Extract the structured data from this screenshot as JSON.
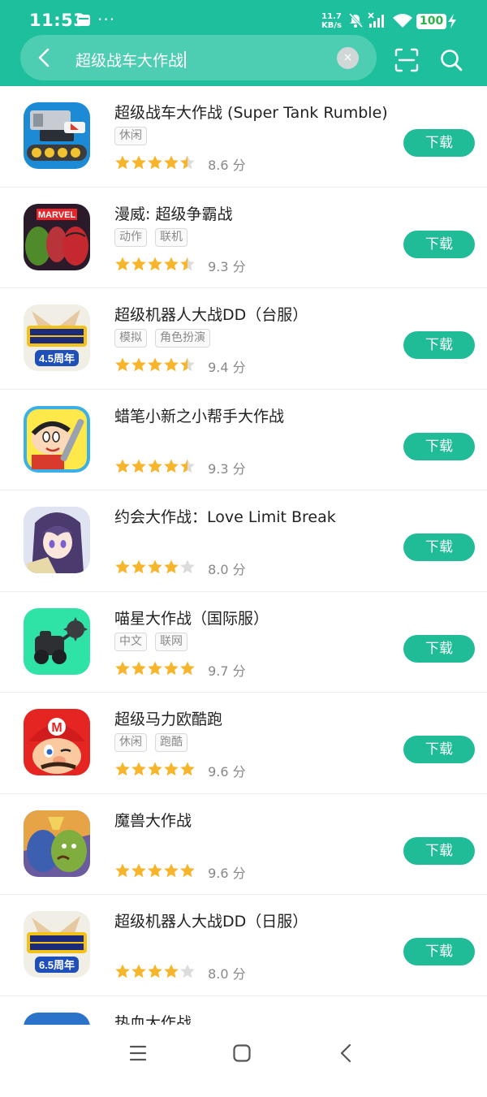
{
  "status": {
    "time": "11:53",
    "dots": "···",
    "net_speed": "11.7",
    "net_unit": "KB/s",
    "battery": "100"
  },
  "search": {
    "query": "超级战车大作战",
    "clear_symbol": "×"
  },
  "apps": [
    {
      "name": "超级战车大作战 (Super Tank Rumble)",
      "tags": [
        "休闲"
      ],
      "rating": 4.5,
      "score": "8.6 分",
      "button": "下载",
      "icon": "super-tank-rumble-icon"
    },
    {
      "name": "漫威: 超级争霸战",
      "tags": [
        "动作",
        "联机"
      ],
      "rating": 4.5,
      "score": "9.3 分",
      "button": "下载",
      "icon": "marvel-contest-icon"
    },
    {
      "name": "超级机器人大战DD（台服）",
      "tags": [
        "模拟",
        "角色扮演"
      ],
      "rating": 4.5,
      "score": "9.4 分",
      "button": "下载",
      "icon": "srw-dd-tw-icon"
    },
    {
      "name": "蜡笔小新之小帮手大作战",
      "tags": [],
      "rating": 4.5,
      "score": "9.3 分",
      "button": "下载",
      "icon": "crayon-shinchan-icon"
    },
    {
      "name": "约会大作战：Love Limit Break",
      "tags": [],
      "rating": 4,
      "score": "8.0 分",
      "button": "下载",
      "icon": "date-a-live-icon"
    },
    {
      "name": "喵星大作战（国际服）",
      "tags": [
        "中文",
        "联网"
      ],
      "rating": 5,
      "score": "9.7 分",
      "button": "下载",
      "icon": "cats-clash-icon"
    },
    {
      "name": "超级马力欧酷跑",
      "tags": [
        "休闲",
        "跑酷"
      ],
      "rating": 5,
      "score": "9.6 分",
      "button": "下载",
      "icon": "super-mario-run-icon"
    },
    {
      "name": "魔兽大作战",
      "tags": [],
      "rating": 5,
      "score": "9.6 分",
      "button": "下载",
      "icon": "warcraft-rumble-icon"
    },
    {
      "name": "超级机器人大战DD（日服）",
      "tags": [],
      "rating": 4,
      "score": "8.0 分",
      "button": "下载",
      "icon": "srw-dd-jp-icon"
    },
    {
      "name": "热血大作战",
      "tags": [],
      "rating": 0,
      "score": "",
      "button": "",
      "icon": "hot-blood-icon"
    }
  ],
  "icon_badges": {
    "marvel": "MARVEL",
    "srw_tw": "4.5周年",
    "srw_jp": "6.5周年"
  },
  "colors": {
    "accent": "#1dbf9d",
    "button": "#20bc97",
    "star": "#f7b52c",
    "star_empty": "#dcdcdc"
  }
}
